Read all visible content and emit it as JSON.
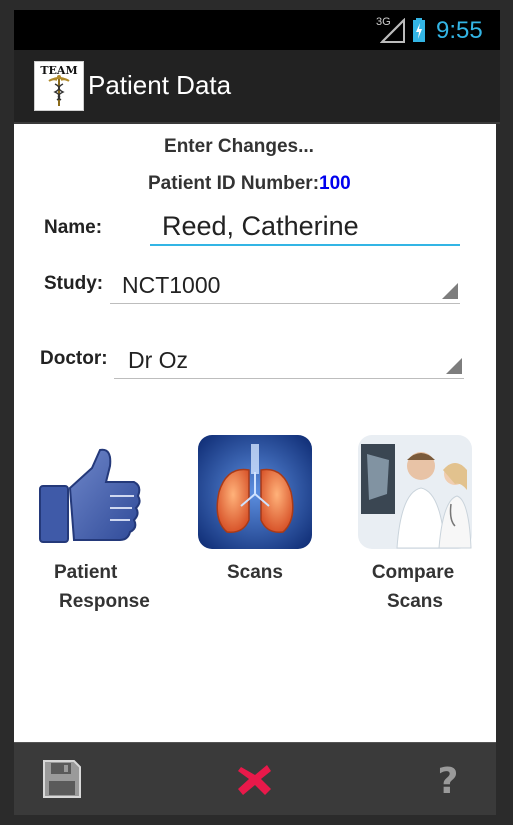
{
  "status": {
    "network": "3G",
    "time": "9:55"
  },
  "action_bar": {
    "logo_text": "TEAM",
    "title": "Patient Data"
  },
  "form": {
    "heading": "Enter Changes...",
    "patient_id_label": "Patient ID Number:",
    "patient_id_value": "100",
    "name_label": "Name:",
    "name_value": "Reed, Catherine",
    "study_label": "Study:",
    "study_value": "NCT1000",
    "doctor_label": "Doctor:",
    "doctor_value": "Dr Oz"
  },
  "tiles": [
    {
      "caption_line1": "Patient",
      "caption_line2": "Response",
      "icon": "thumbs-up-icon"
    },
    {
      "caption_line1": "Scans",
      "caption_line2": "",
      "icon": "lungs-scan-icon"
    },
    {
      "caption_line1": "Compare",
      "caption_line2": "Scans",
      "icon": "doctors-reviewing-scan-icon"
    }
  ],
  "bottom_bar": {
    "save_icon": "floppy-disk-icon",
    "cancel_icon": "red-x-icon",
    "help_icon": "question-mark-icon"
  },
  "colors": {
    "accent": "#33b5e5",
    "id_value": "#0000ee",
    "cancel": "#e8194a",
    "action_bar": "#222222",
    "bottom_bar": "#3a3a3a"
  }
}
